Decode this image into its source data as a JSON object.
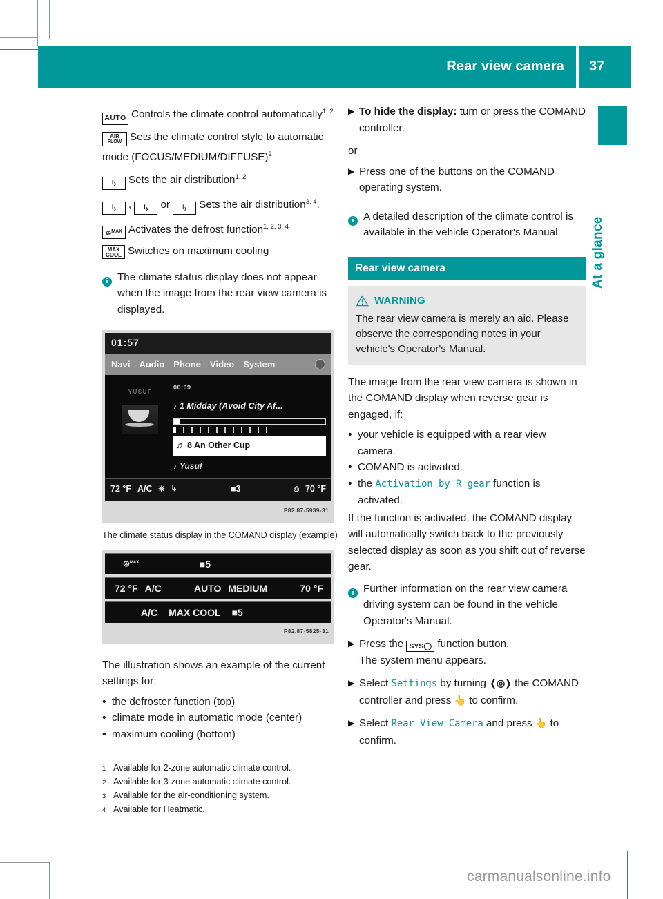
{
  "header": {
    "title": "Rear view camera",
    "page_number": "37",
    "accent_color": "#00989a"
  },
  "side_tab": {
    "label": "At a glance"
  },
  "left_column": {
    "climate_controls": [
      {
        "icon": "auto-button-icon",
        "icon_label": "AUTO",
        "text": "Controls the climate control automatically",
        "footnote_refs": "1, 2"
      },
      {
        "icon": "air-flow-button-icon",
        "icon_line1": "AIR",
        "icon_line2": "FLOW",
        "text": "Sets the climate control style to automatic mode (FOCUS/MEDIUM/DIFFUSE)",
        "footnote_refs": "2"
      },
      {
        "icon": "air-distribution-button-icon",
        "icon_glyph": "⤵",
        "text": "Sets the air distribution",
        "footnote_refs": "1, 2"
      },
      {
        "icon": "air-distribution-variants-icon",
        "text_prefix": "",
        "separator_comma": ",",
        "separator_or": "or",
        "text": "Sets the air distribution",
        "footnote_refs": "3, 4",
        "trailing": "."
      },
      {
        "icon": "defrost-max-button-icon",
        "icon_label": "MAX",
        "text": "Activates the defrost function",
        "footnote_refs": "1, 2, 3, 4"
      },
      {
        "icon": "max-cool-button-icon",
        "icon_line1": "MAX",
        "icon_line2": "COOL",
        "text": "Switches on maximum cooling",
        "footnote_refs": ""
      }
    ],
    "info_note": "The climate status display does not appear when the image from the rear view camera is displayed.",
    "figure1": {
      "name": "comand-media-display-figure",
      "clock": "01:57",
      "menu_items": [
        "Navi",
        "Audio",
        "Phone",
        "Video",
        "System"
      ],
      "selected_menu": "Audio",
      "cover_title": "YUSUF",
      "elapsed": "00:09",
      "track_title": "1 Midday (Avoid City Af...",
      "selected_entry": "8 An Other Cup",
      "artist": "Yusuf",
      "status_left_temp": "72 °F",
      "status_ac": "A/C",
      "status_fan": "3",
      "status_right_temp": "70 °F",
      "code": "P82.87-5939-31"
    },
    "figure1_caption": "The climate status display in the COMAND display (example)",
    "figure2": {
      "name": "climate-status-bars-figure",
      "bar_top": {
        "icon": "defrost-max-icon",
        "fan": "5"
      },
      "bar_middle": {
        "left_temp": "72 °F",
        "ac": "A/C",
        "mode": "AUTO",
        "style": "MEDIUM",
        "right_temp": "70 °F"
      },
      "bar_bottom": {
        "ac": "A/C",
        "mode": "MAX COOL",
        "fan": "5"
      },
      "code": "P82.87-5825-31"
    },
    "illustration_intro": "The illustration shows an example of the current settings for:",
    "illustration_items": [
      "the defroster function (top)",
      "climate mode in automatic mode (center)",
      "maximum cooling (bottom)"
    ]
  },
  "right_column": {
    "step_hide_display": {
      "bold": "To hide the display:",
      "rest": " turn or press the COMAND controller."
    },
    "or_label": "or",
    "step_press_buttons": "Press one of the buttons on the COMAND operating system.",
    "info_detailed": "A detailed description of the climate control is available in the vehicle Operator's Manual.",
    "section_title": "Rear view camera",
    "warning": {
      "title": "WARNING",
      "body": "The rear view camera is merely an aid. Please observe the corresponding notes in your vehicle's Operator's Manual."
    },
    "intro": "The image from the rear view camera is shown in the COMAND display when reverse gear is engaged, if:",
    "conditions": [
      {
        "text": "your vehicle is equipped with a rear view camera."
      },
      {
        "text": "COMAND is activated."
      },
      {
        "prefix": "the ",
        "mono": "Activation by R gear",
        "suffix": " function is activated."
      }
    ],
    "after_conditions": "If the function is activated, the COMAND display will automatically switch back to the previously selected display as soon as you shift out of reverse gear.",
    "info_further": "Further information on the rear view camera driving system can be found in the vehicle Operator's Manual.",
    "step_press_sys": {
      "prefix": "Press the ",
      "button": "SYS",
      "suffix": " function button.",
      "result": "The system menu appears."
    },
    "step_select_settings": {
      "prefix": "Select ",
      "mono": "Settings",
      "mid": " by turning ",
      "turn_icon": "controller-turn-icon",
      "mid2": " the COMAND controller and press ",
      "press_icon": "controller-press-icon",
      "suffix": " to confirm."
    },
    "step_select_rvc": {
      "prefix": "Select ",
      "mono": "Rear View Camera",
      "mid": " and press ",
      "press_icon": "controller-press-icon",
      "suffix": " to confirm."
    }
  },
  "footnotes": [
    {
      "num": "1",
      "text": "Available for 2-zone automatic climate control."
    },
    {
      "num": "2",
      "text": "Available for 3-zone automatic climate control."
    },
    {
      "num": "3",
      "text": "Available for the air-conditioning system."
    },
    {
      "num": "4",
      "text": "Available for Heatmatic."
    }
  ],
  "watermark": "carmanualsonline.info"
}
